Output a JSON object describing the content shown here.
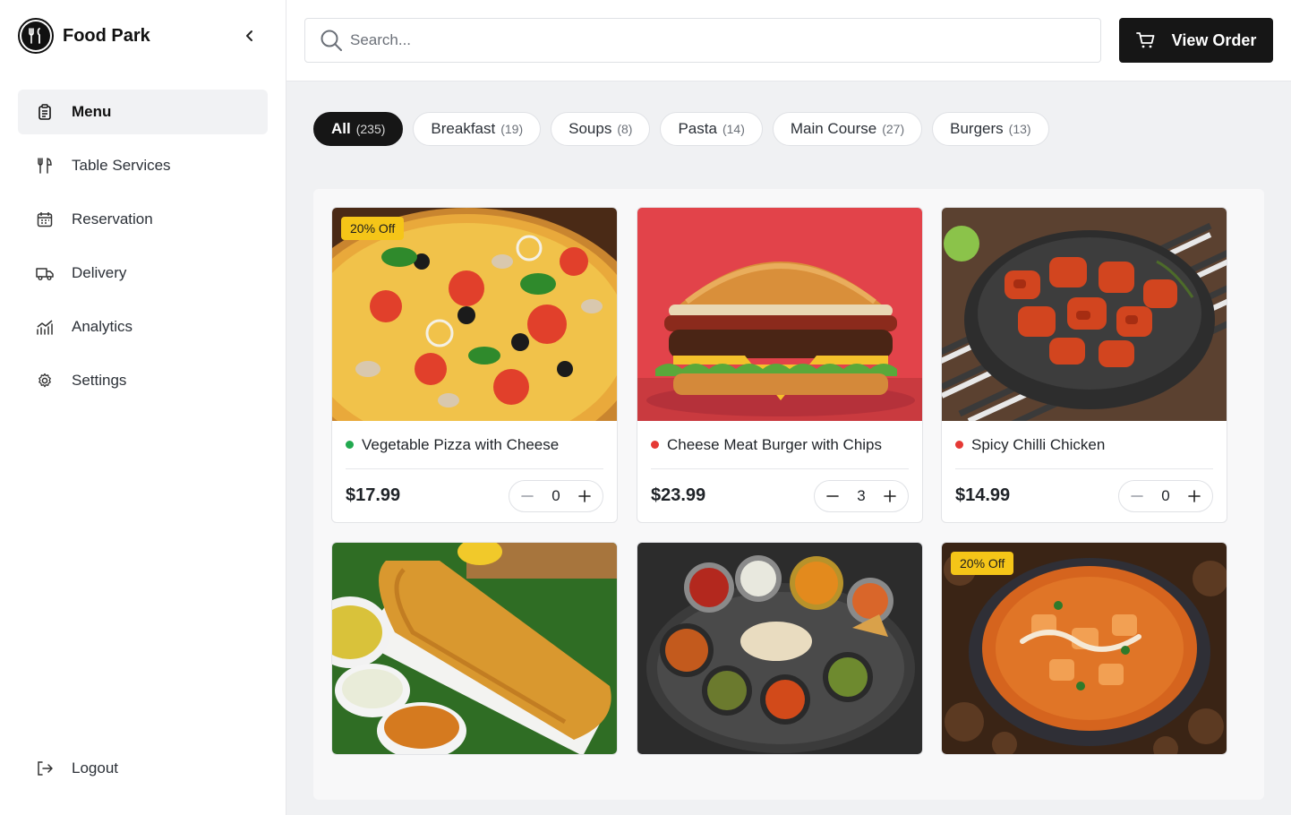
{
  "brand": {
    "name": "Food Park"
  },
  "sidebar": {
    "items": [
      {
        "label": "Menu",
        "icon": "clipboard-icon",
        "active": true
      },
      {
        "label": "Table Services",
        "icon": "fork-knife-icon",
        "active": false
      },
      {
        "label": "Reservation",
        "icon": "calendar-icon",
        "active": false
      },
      {
        "label": "Delivery",
        "icon": "truck-icon",
        "active": false
      },
      {
        "label": "Analytics",
        "icon": "chart-icon",
        "active": false
      },
      {
        "label": "Settings",
        "icon": "gear-icon",
        "active": false
      }
    ],
    "logout_label": "Logout"
  },
  "search": {
    "placeholder": "Search..."
  },
  "header": {
    "view_order_label": "View Order"
  },
  "categories": [
    {
      "label": "All",
      "count": "(235)",
      "active": true
    },
    {
      "label": "Breakfast",
      "count": "(19)",
      "active": false
    },
    {
      "label": "Soups",
      "count": "(8)",
      "active": false
    },
    {
      "label": "Pasta",
      "count": "(14)",
      "active": false
    },
    {
      "label": "Main Course",
      "count": "(27)",
      "active": false
    },
    {
      "label": "Burgers",
      "count": "(13)",
      "active": false
    }
  ],
  "products": [
    {
      "name": "Vegetable Pizza with Cheese",
      "price": "$17.99",
      "qty": "0",
      "badge": "20% Off",
      "veg": true,
      "image": "pizza"
    },
    {
      "name": "Cheese Meat Burger with Chips",
      "price": "$23.99",
      "qty": "3",
      "badge": "",
      "veg": false,
      "image": "burger"
    },
    {
      "name": "Spicy Chilli Chicken",
      "price": "$14.99",
      "qty": "0",
      "badge": "",
      "veg": false,
      "image": "chicken"
    },
    {
      "name": "",
      "price": "",
      "qty": "",
      "badge": "",
      "image": "dosa"
    },
    {
      "name": "",
      "price": "",
      "qty": "",
      "badge": "",
      "image": "thali"
    },
    {
      "name": "",
      "price": "",
      "qty": "",
      "badge": "20% Off",
      "image": "curry"
    }
  ],
  "colors": {
    "veg": "#22a94f",
    "nonveg": "#e53935",
    "badge": "#f5c518",
    "primary": "#161616"
  }
}
